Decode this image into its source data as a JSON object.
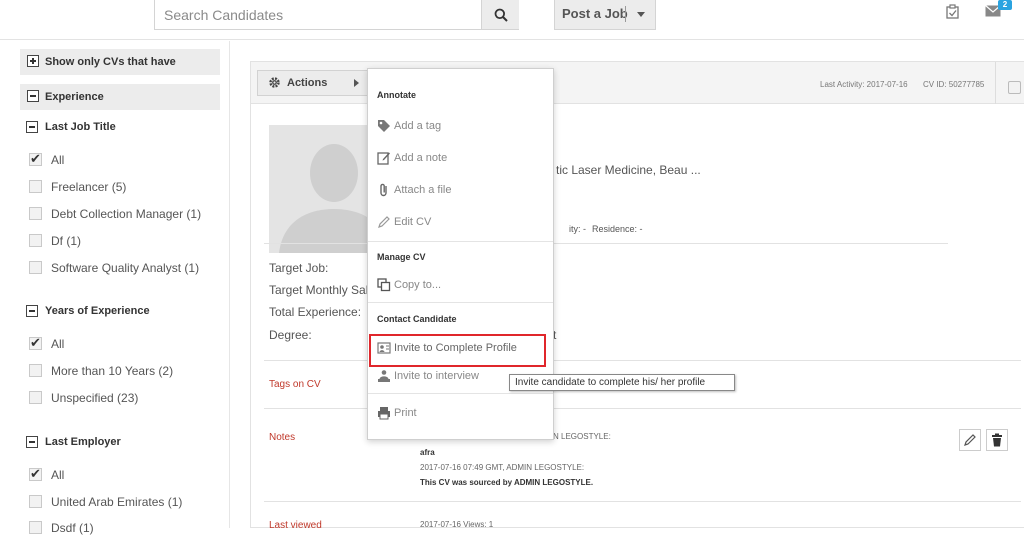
{
  "header": {
    "search_placeholder": "Search Candidates",
    "post_job_label": "Post a Job",
    "mail_count": "2"
  },
  "sidebar": {
    "show_only_label": "Show only CVs that have",
    "experience_label": "Experience",
    "groups": [
      {
        "title": "Last Job Title",
        "options": [
          {
            "label": "All",
            "checked": true
          },
          {
            "label": "Freelancer (5)",
            "checked": false
          },
          {
            "label": "Debt Collection Manager (1)",
            "checked": false
          },
          {
            "label": "Df (1)",
            "checked": false
          },
          {
            "label": "Software Quality Analyst (1)",
            "checked": false
          }
        ]
      },
      {
        "title": "Years of Experience",
        "options": [
          {
            "label": "All",
            "checked": true
          },
          {
            "label": "More than 10 Years (2)",
            "checked": false
          },
          {
            "label": "Unspecified (23)",
            "checked": false
          }
        ]
      },
      {
        "title": "Last Employer",
        "options": [
          {
            "label": "All",
            "checked": true
          },
          {
            "label": "United Arab Emirates (1)",
            "checked": false
          },
          {
            "label": "Dsdf (1)",
            "checked": false
          }
        ]
      }
    ]
  },
  "cv": {
    "actions_label": "Actions",
    "last_activity": "Last Activity: 2017-07-16",
    "cv_id": "CV ID: 50277785",
    "headline_partial": "tic Laser Medicine, Beau ...",
    "nationality_partial": "ity: -",
    "residence": "Residence: -",
    "target_job": "Target Job:",
    "target_salary": "Target Monthly Sal",
    "total_experience": "Total Experience:",
    "degree": "Degree:",
    "degree_value_partial": "t",
    "tags_label": "Tags on CV",
    "notes_label": "Notes",
    "note_1_partial": "N LEGOSTYLE:",
    "note_2": "afra",
    "note_3": "2017-07-16 07:49 GMT, ADMIN LEGOSTYLE:",
    "note_4": "This CV was sourced by ADMIN LEGOSTYLE.",
    "last_viewed_label": "Last viewed",
    "last_viewed_value": "2017-07-16 Views: 1"
  },
  "menu": {
    "annotate_header": "Annotate",
    "add_tag": "Add a tag",
    "add_note": "Add a note",
    "attach_file": "Attach a file",
    "edit_cv": "Edit CV",
    "manage_header": "Manage CV",
    "copy_to": "Copy to...",
    "contact_header": "Contact Candidate",
    "invite_complete": "Invite to Complete Profile",
    "invite_interview": "Invite to interview",
    "print": "Print"
  },
  "tooltip": {
    "text": "Invite candidate to complete his/ her profile"
  },
  "colors": {
    "highlight_border": "#e0262b",
    "section_label": "#c0392b",
    "badge": "#2aa3e0"
  }
}
